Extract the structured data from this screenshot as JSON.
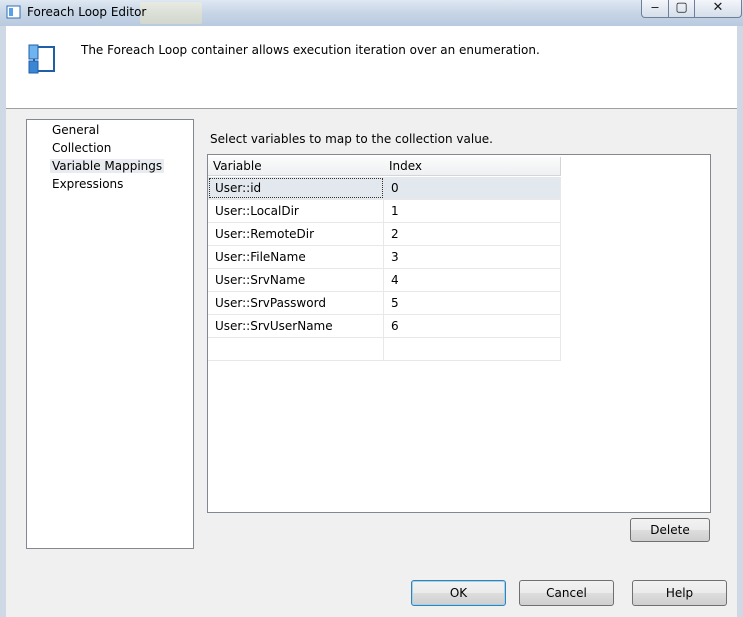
{
  "window": {
    "title": "Foreach Loop Editor"
  },
  "header": {
    "description": "The Foreach Loop container allows execution iteration over an enumeration."
  },
  "nav": {
    "items": [
      "General",
      "Collection",
      "Variable Mappings",
      "Expressions"
    ],
    "selected": "Variable Mappings"
  },
  "mappings": {
    "instruction": "Select variables to map to the collection value.",
    "columns": [
      "Variable",
      "Index"
    ],
    "rows": [
      {
        "variable": "User::id",
        "index": "0"
      },
      {
        "variable": "User::LocalDir",
        "index": "1"
      },
      {
        "variable": "User::RemoteDir",
        "index": "2"
      },
      {
        "variable": "User::FileName",
        "index": "3"
      },
      {
        "variable": "User::SrvName",
        "index": "4"
      },
      {
        "variable": "User::SrvPassword",
        "index": "5"
      },
      {
        "variable": "User::SrvUserName",
        "index": "6"
      }
    ]
  },
  "buttons": {
    "delete": "Delete",
    "ok": "OK",
    "cancel": "Cancel",
    "help": "Help"
  },
  "window_controls": {
    "minimize": "‒",
    "maximize": "▢",
    "close": "✕"
  },
  "colors": {
    "selected_row": "#e3e8ee",
    "nav_selected": "#e8ecf0"
  }
}
